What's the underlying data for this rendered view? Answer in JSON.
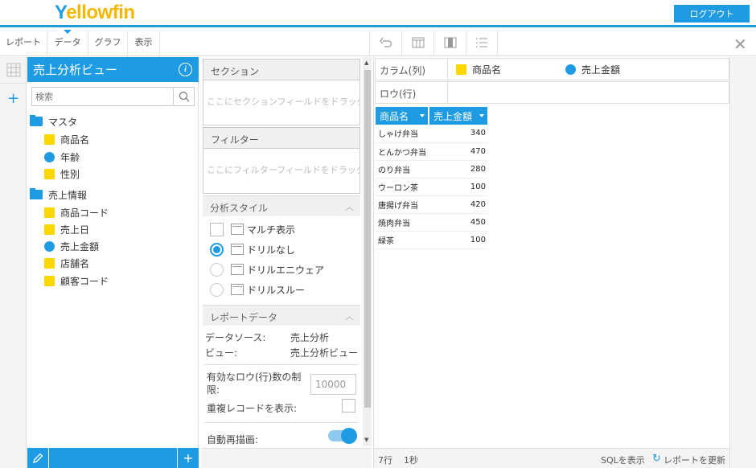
{
  "header": {
    "logo_text": "Yellowfin",
    "logout_label": "ログアウト"
  },
  "toolbar": {
    "tabs": [
      "レポート",
      "データ",
      "グラフ",
      "表示"
    ],
    "active_tab": "データ",
    "icons": [
      "undo-icon",
      "table-layout-icon",
      "panel-layout-icon",
      "list-format-icon"
    ],
    "close_icon": "close-icon"
  },
  "fieldpanel": {
    "view_title": "売上分析ビュー",
    "search_placeholder": "検索",
    "folders": [
      {
        "name": "マスタ",
        "fields": [
          {
            "label": "商品名",
            "kind": "dimension"
          },
          {
            "label": "年齢",
            "kind": "metric"
          },
          {
            "label": "性別",
            "kind": "dimension"
          }
        ]
      },
      {
        "name": "売上情報",
        "fields": [
          {
            "label": "商品コード",
            "kind": "dimension"
          },
          {
            "label": "売上日",
            "kind": "dimension"
          },
          {
            "label": "売上金額",
            "kind": "metric"
          },
          {
            "label": "店舗名",
            "kind": "dimension"
          },
          {
            "label": "顧客コード",
            "kind": "dimension"
          }
        ]
      }
    ]
  },
  "config": {
    "section_label": "セクション",
    "section_placeholder": "ここにセクションフィールドをドラッグ",
    "filter_label": "フィルター",
    "filter_placeholder": "ここにフィルターフィールドをドラッグ",
    "analysis_style_label": "分析スタイル",
    "multi_display_label": "マルチ表示",
    "drill_options": [
      "ドリルなし",
      "ドリルエニウェア",
      "ドリルスルー"
    ],
    "selected_drill": "ドリルなし",
    "report_data_label": "レポートデータ",
    "datasource_key": "データソース:",
    "datasource_value": "売上分析",
    "view_key": "ビュー:",
    "view_value": "売上分析ビュー",
    "max_rows_label": "有効なロウ(行)数の制限:",
    "max_rows_value": "10000",
    "show_duplicates_label": "重複レコードを表示:",
    "auto_redraw_label": "自動再描画:",
    "auto_redraw_on": true
  },
  "report": {
    "columns_label": "カラム(列)",
    "rows_label": "ロウ(行)",
    "column_fields": [
      {
        "label": "商品名",
        "kind": "dimension"
      },
      {
        "label": "売上金額",
        "kind": "metric"
      }
    ],
    "table": {
      "headers": [
        "商品名",
        "売上金額"
      ],
      "rows": [
        [
          "しゃけ弁当",
          "340"
        ],
        [
          "とんかつ弁当",
          "470"
        ],
        [
          "のり弁当",
          "280"
        ],
        [
          "ウーロン茶",
          "100"
        ],
        [
          "唐揚げ弁当",
          "420"
        ],
        [
          "焼肉弁当",
          "450"
        ],
        [
          "緑茶",
          "100"
        ]
      ]
    },
    "status_rows": "7行",
    "status_time": "1秒",
    "sql_link": "SQLを表示",
    "refresh_link": "レポートを更新"
  },
  "colors": {
    "accent": "#1e9be3",
    "dimension": "#ffd700",
    "metric": "#1e9be3"
  }
}
